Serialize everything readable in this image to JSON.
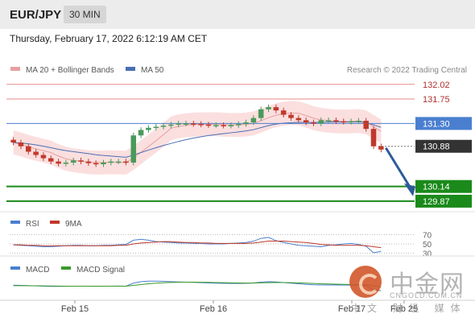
{
  "header": {
    "pair": "EUR/JPY",
    "timeframe": "30 MIN",
    "datetime": "Thursday, February 17, 2022 6:12:19 AM CET"
  },
  "credit": "Research © 2022 Trading Central",
  "watermark": {
    "cn": "中金网",
    "url": "CNGOLD.COM.CN",
    "sub": "中文 财经 媒体"
  },
  "colors": {
    "up": "#4a9a5a",
    "down": "#c0392b",
    "band": "#f7c5c5",
    "ma20": "#e8a0a0",
    "ma50": "#4a6fb5",
    "resistance": "#e88a8a",
    "pivot": "#4a7fd0",
    "support": "#1a8a1a",
    "price": "#333333"
  },
  "chart_data": [
    {
      "type": "line",
      "title": "",
      "legend": [
        {
          "name": "MA 20 + Bollinger Bands"
        },
        {
          "name": "MA 50"
        }
      ],
      "ylim": [
        129.75,
        132.15
      ],
      "x_labels": [
        "Feb 15",
        "Feb 16",
        "Feb 17",
        "Feb 25"
      ],
      "levels": [
        {
          "label": "132.02",
          "value": 132.02,
          "kind": "resistance"
        },
        {
          "label": "131.75",
          "value": 131.75,
          "kind": "resistance"
        },
        {
          "label": "131.30",
          "value": 131.3,
          "kind": "pivot"
        },
        {
          "label": "130.88",
          "value": 130.88,
          "kind": "price"
        },
        {
          "label": "130.14",
          "value": 130.14,
          "kind": "support"
        },
        {
          "label": "129.87",
          "value": 129.87,
          "kind": "support"
        }
      ],
      "close_series": [
        130.95,
        130.88,
        130.78,
        130.72,
        130.66,
        130.6,
        130.56,
        130.58,
        130.62,
        130.6,
        130.57,
        130.55,
        130.58,
        130.6,
        130.6,
        130.58,
        131.08,
        131.18,
        131.22,
        131.24,
        131.26,
        131.28,
        131.3,
        131.3,
        131.29,
        131.28,
        131.27,
        131.27,
        131.26,
        131.27,
        131.29,
        131.32,
        131.4,
        131.56,
        131.6,
        131.54,
        131.46,
        131.4,
        131.36,
        131.32,
        131.3,
        131.36,
        131.36,
        131.34,
        131.33,
        131.34,
        131.35,
        131.2,
        130.88,
        130.82
      ],
      "forecast": {
        "from": 130.85,
        "to": 130.02
      }
    },
    {
      "type": "line",
      "title": "",
      "legend": [
        {
          "name": "RSI"
        },
        {
          "name": "9MA"
        }
      ],
      "ylim": [
        24,
        76
      ],
      "levels": [
        {
          "label": "70",
          "value": 70
        },
        {
          "label": "50",
          "value": 50
        },
        {
          "label": "30",
          "value": 30
        }
      ],
      "rsi": [
        48,
        47,
        46,
        45,
        44,
        44,
        45,
        46,
        47,
        47,
        46,
        46,
        47,
        47,
        48,
        49,
        58,
        60,
        58,
        55,
        54,
        53,
        52,
        52,
        51,
        51,
        50,
        50,
        50,
        51,
        52,
        53,
        56,
        62,
        64,
        57,
        53,
        50,
        47,
        46,
        45,
        44,
        47,
        48,
        50,
        51,
        49,
        45,
        31,
        34
      ],
      "ma9": [
        48,
        48,
        47,
        47,
        46,
        46,
        46,
        46,
        46,
        46,
        46,
        46,
        46,
        46,
        47,
        47,
        50,
        52,
        53,
        54,
        55,
        55,
        54,
        53,
        53,
        52,
        52,
        51,
        51,
        51,
        51,
        51,
        52,
        54,
        56,
        56,
        56,
        55,
        54,
        53,
        51,
        49,
        48,
        47,
        47,
        47,
        47,
        46,
        44,
        42
      ]
    },
    {
      "type": "line",
      "title": "",
      "legend": [
        {
          "name": "MACD"
        },
        {
          "name": "MACD Signal"
        }
      ],
      "ylim": [
        -1,
        1
      ],
      "macd": [
        0.1,
        0.08,
        0.05,
        0.03,
        0.0,
        -0.02,
        -0.02,
        -0.01,
        0.0,
        0.0,
        0.0,
        -0.01,
        0.0,
        0.0,
        0.01,
        0.0,
        0.3,
        0.45,
        0.5,
        0.5,
        0.48,
        0.45,
        0.42,
        0.4,
        0.38,
        0.35,
        0.32,
        0.3,
        0.28,
        0.27,
        0.27,
        0.28,
        0.32,
        0.4,
        0.45,
        0.42,
        0.36,
        0.3,
        0.24,
        0.18,
        0.14,
        0.12,
        0.12,
        0.12,
        0.11,
        0.11,
        0.1,
        0.02,
        -0.35,
        -0.45
      ],
      "signal": [
        0.05,
        0.05,
        0.05,
        0.04,
        0.03,
        0.02,
        0.01,
        0.0,
        0.0,
        0.0,
        0.0,
        0.0,
        0.0,
        0.0,
        0.0,
        0.0,
        0.08,
        0.16,
        0.24,
        0.3,
        0.34,
        0.37,
        0.39,
        0.4,
        0.4,
        0.39,
        0.38,
        0.36,
        0.35,
        0.33,
        0.32,
        0.31,
        0.31,
        0.33,
        0.35,
        0.36,
        0.36,
        0.35,
        0.33,
        0.3,
        0.27,
        0.24,
        0.22,
        0.2,
        0.18,
        0.17,
        0.15,
        0.13,
        0.03,
        -0.07
      ]
    }
  ]
}
